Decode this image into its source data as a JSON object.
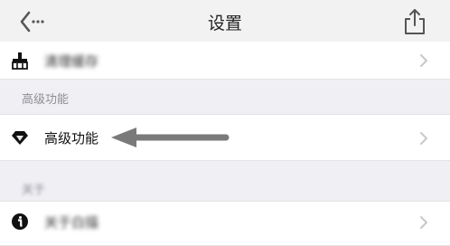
{
  "nav": {
    "title": "设置",
    "back_icon": "back-arrow-icon",
    "share_icon": "share-icon"
  },
  "rows": {
    "clear_cache": {
      "label": "清理缓存",
      "icon": "broom-icon"
    },
    "advanced": {
      "label": "高级功能",
      "icon": "diamond-icon"
    },
    "about": {
      "label": "关于白描",
      "icon": "info-icon"
    }
  },
  "sections": {
    "advanced_header": "高级功能",
    "about_header": "关于"
  },
  "colors": {
    "background": "#efeff4",
    "row_bg": "#ffffff",
    "header_text": "#8e8e93",
    "chevron": "#c7c7cc",
    "annotation_arrow": "#7a7a7a"
  }
}
